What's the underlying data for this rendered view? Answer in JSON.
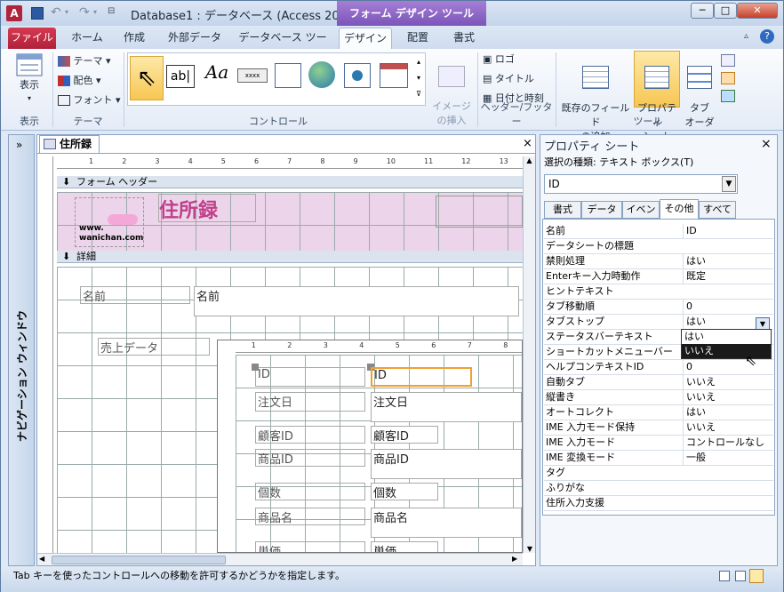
{
  "window": {
    "title": "Database1 : データベース (Access 200...",
    "context_tab": "フォーム デザイン ツール",
    "minimize": "─",
    "maximize": "□",
    "close": "✕"
  },
  "tabs": [
    {
      "label": "ファイル"
    },
    {
      "label": "ホーム"
    },
    {
      "label": "作成"
    },
    {
      "label": "外部データ"
    },
    {
      "label": "データベース ツール"
    },
    {
      "label": "デザイン"
    },
    {
      "label": "配置"
    },
    {
      "label": "書式"
    }
  ],
  "ribbon": {
    "view": {
      "label": "表示",
      "group": "表示"
    },
    "theme": {
      "themes": "テーマ",
      "colors": "配色",
      "fonts": "フォント",
      "group": "テーマ"
    },
    "controls": {
      "group": "コントロール",
      "label_glyph": "Aa",
      "text_glyph": "ab|"
    },
    "image": {
      "label": "イメージ\nの挿入"
    },
    "header_footer": {
      "logo": "ロゴ",
      "title": "タイトル",
      "datetime": "日付と時刻",
      "group": "ヘッダー/フッター"
    },
    "tools": {
      "add_fields": "既存のフィールド\nの追加",
      "property_sheet": "プロパティ\nシート",
      "tab_order": "タブ\nオーダー",
      "group": "ツール"
    }
  },
  "nav_pane": {
    "label": "ナビゲーション ウィンドウ",
    "toggle": "»"
  },
  "document": {
    "tab_title": "住所録",
    "close": "×",
    "form_header_label": "フォーム ヘッダー",
    "detail_label": "詳細",
    "logo_text": "www.\nwanichan.com",
    "title": "住所録",
    "controls": [
      {
        "label": "名前",
        "value": "名前"
      },
      {
        "label": "売上データ"
      }
    ],
    "subform": [
      {
        "label": "ID",
        "value": "ID"
      },
      {
        "label": "注文日",
        "value": "注文日"
      },
      {
        "label": "顧客ID",
        "value": "顧客ID"
      },
      {
        "label": "商品ID",
        "value": "商品ID"
      },
      {
        "label": "個数",
        "value": "個数"
      },
      {
        "label": "商品名",
        "value": "商品名"
      },
      {
        "label": "単価",
        "value": "単価"
      }
    ],
    "ruler_numbers": [
      "1",
      "2",
      "3",
      "4",
      "5",
      "6",
      "7",
      "8",
      "9",
      "10",
      "11",
      "12",
      "13"
    ],
    "sub_ruler_numbers": [
      "1",
      "2",
      "3",
      "4",
      "5",
      "6",
      "7",
      "8"
    ],
    "vruler_numbers": [
      "1",
      "2",
      "3",
      "4",
      "5",
      "6"
    ]
  },
  "properties": {
    "title": "プロパティ シート",
    "close": "×",
    "selection_type": "選択の種類: テキスト ボックス(T)",
    "selected_object": "ID",
    "tabs": [
      "書式",
      "データ",
      "イベント",
      "その他",
      "すべて"
    ],
    "active_tab": "その他",
    "rows": [
      {
        "name": "名前",
        "value": "ID"
      },
      {
        "name": "データシートの標題",
        "value": ""
      },
      {
        "name": "禁則処理",
        "value": "はい"
      },
      {
        "name": "Enterキー入力時動作",
        "value": "既定"
      },
      {
        "name": "ヒントテキスト",
        "value": ""
      },
      {
        "name": "タブ移動順",
        "value": "0"
      },
      {
        "name": "タブストップ",
        "value": "はい"
      },
      {
        "name": "ステータスバーテキスト",
        "value": ""
      },
      {
        "name": "ショートカットメニューバー",
        "value": ""
      },
      {
        "name": "ヘルプコンテキストID",
        "value": "0"
      },
      {
        "name": "自動タブ",
        "value": "いいえ"
      },
      {
        "name": "縦書き",
        "value": "いいえ"
      },
      {
        "name": "オートコレクト",
        "value": "はい"
      },
      {
        "name": "IME 入力モード保持",
        "value": "いいえ"
      },
      {
        "name": "IME 入力モード",
        "value": "コントロールなし"
      },
      {
        "name": "IME 変換モード",
        "value": "一般"
      },
      {
        "name": "タグ",
        "value": ""
      },
      {
        "name": "ふりがな",
        "value": ""
      },
      {
        "name": "住所入力支援",
        "value": ""
      }
    ],
    "dropdown_options": [
      "はい",
      "いいえ"
    ],
    "dropdown_highlighted": "いいえ"
  },
  "status": {
    "text": "Tab キーを使ったコントロールへの移動を許可するかどうかを指定します。"
  },
  "colors": {
    "accent": "#7b55b8",
    "file_tab": "#c32b44",
    "header_band": "#ecd5ea",
    "title_text": "#c0408a",
    "selection": "#f0a030"
  }
}
